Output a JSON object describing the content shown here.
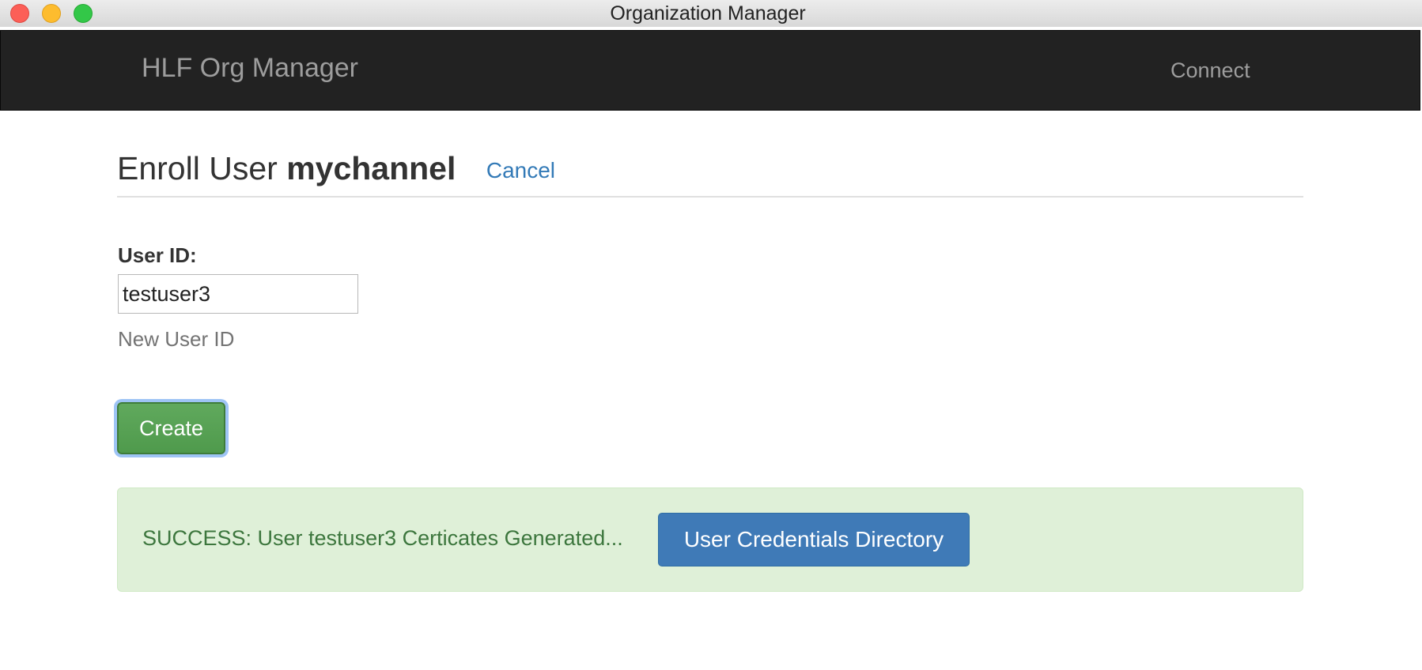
{
  "window": {
    "title": "Organization Manager"
  },
  "navbar": {
    "brand": "HLF Org Manager",
    "connect_label": "Connect"
  },
  "header": {
    "title_prefix": "Enroll User",
    "channel": "mychannel",
    "cancel_label": "Cancel"
  },
  "form": {
    "userid_label": "User ID:",
    "userid_value": "testuser3",
    "userid_help": "New User ID",
    "create_label": "Create"
  },
  "alert": {
    "message": "SUCCESS: User testuser3 Certicates Generated...",
    "credentials_button_label": "User Credentials Directory"
  },
  "colors": {
    "navbar_bg": "#222222",
    "link": "#337ab7",
    "success_bg": "#dff0d8",
    "success_text": "#3c763d",
    "create_button": "#5cb85c",
    "primary_button": "#3f7ab7"
  }
}
